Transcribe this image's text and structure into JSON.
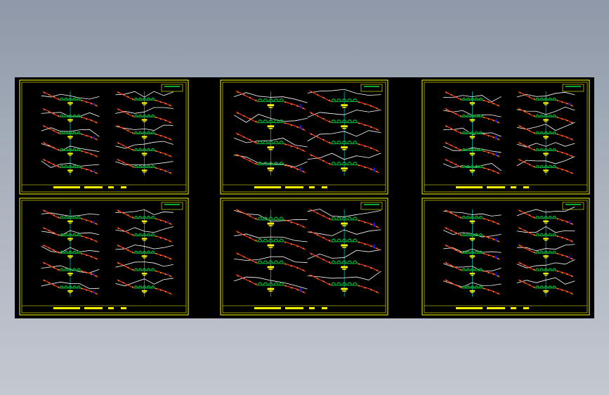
{
  "drawing": {
    "background_color": "#000000",
    "frame_color": "#ffff00",
    "section_road_color": "#00aa33",
    "centerline_color": "#00cccc",
    "ground_line_color": "#ffffff",
    "slope_color": "#ff3322",
    "marker_color": "#ffff00",
    "water_color": "#0022ff"
  },
  "sheets": [
    {
      "id": "sheet-1",
      "title_block_text": ""
    },
    {
      "id": "sheet-2",
      "title_block_text": ""
    },
    {
      "id": "sheet-3",
      "title_block_text": ""
    },
    {
      "id": "sheet-4",
      "title_block_text": ""
    },
    {
      "id": "sheet-5",
      "title_block_text": ""
    },
    {
      "id": "sheet-6",
      "title_block_text": ""
    }
  ]
}
